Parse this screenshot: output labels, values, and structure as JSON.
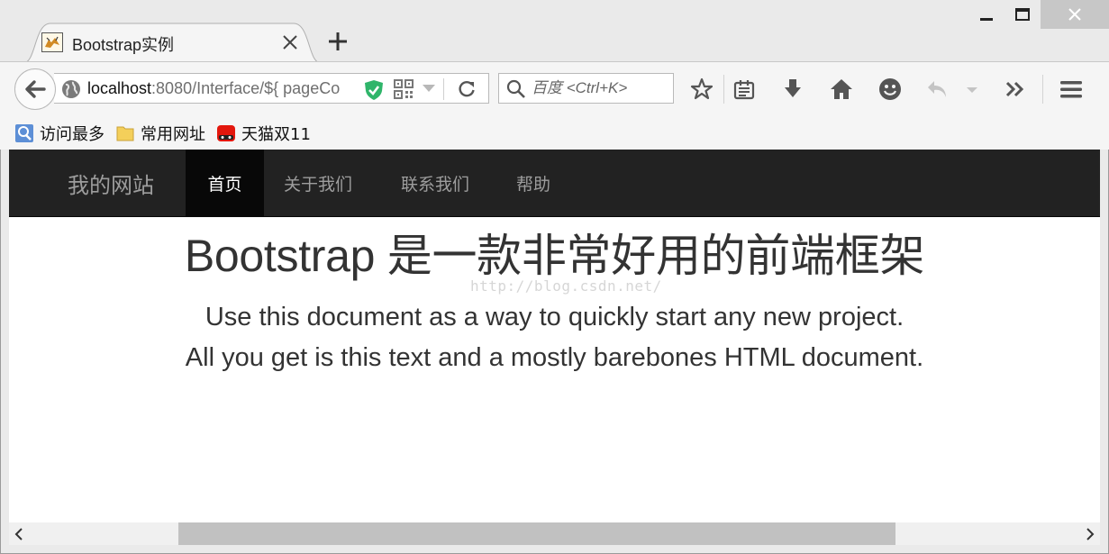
{
  "browser": {
    "tab_title": "Bootstrap实例",
    "url_host": "localhost",
    "url_rest": ":8080/Interface/${ pageCo",
    "search_placeholder": "百度 <Ctrl+K>",
    "bookmarks": [
      "访问最多",
      "常用网址",
      "天猫双11"
    ],
    "icons": {
      "window_controls": [
        "minimize-icon",
        "maximize-icon",
        "close-icon"
      ],
      "toolbar": [
        "star-icon",
        "reading-list-icon",
        "download-icon",
        "home-icon",
        "smiley-icon",
        "undo-icon",
        "overflow-icon",
        "menu-icon"
      ]
    }
  },
  "page": {
    "brand": "我的网站",
    "nav": [
      "首页",
      "关于我们",
      "联系我们",
      "帮助"
    ],
    "active_nav": "首页",
    "heading": "Bootstrap 是一款非常好用的前端框架",
    "lead1": "Use this document as a way to quickly start any new project.",
    "lead2": "All you get is this text and a mostly barebones HTML document.",
    "watermark": "http://blog.csdn.net/"
  },
  "colors": {
    "navbar_bg": "#222222",
    "navbar_active_bg": "#080808",
    "navbar_text": "#9d9d9d",
    "heading_text": "#333333",
    "shield_green": "#2fb56a"
  }
}
